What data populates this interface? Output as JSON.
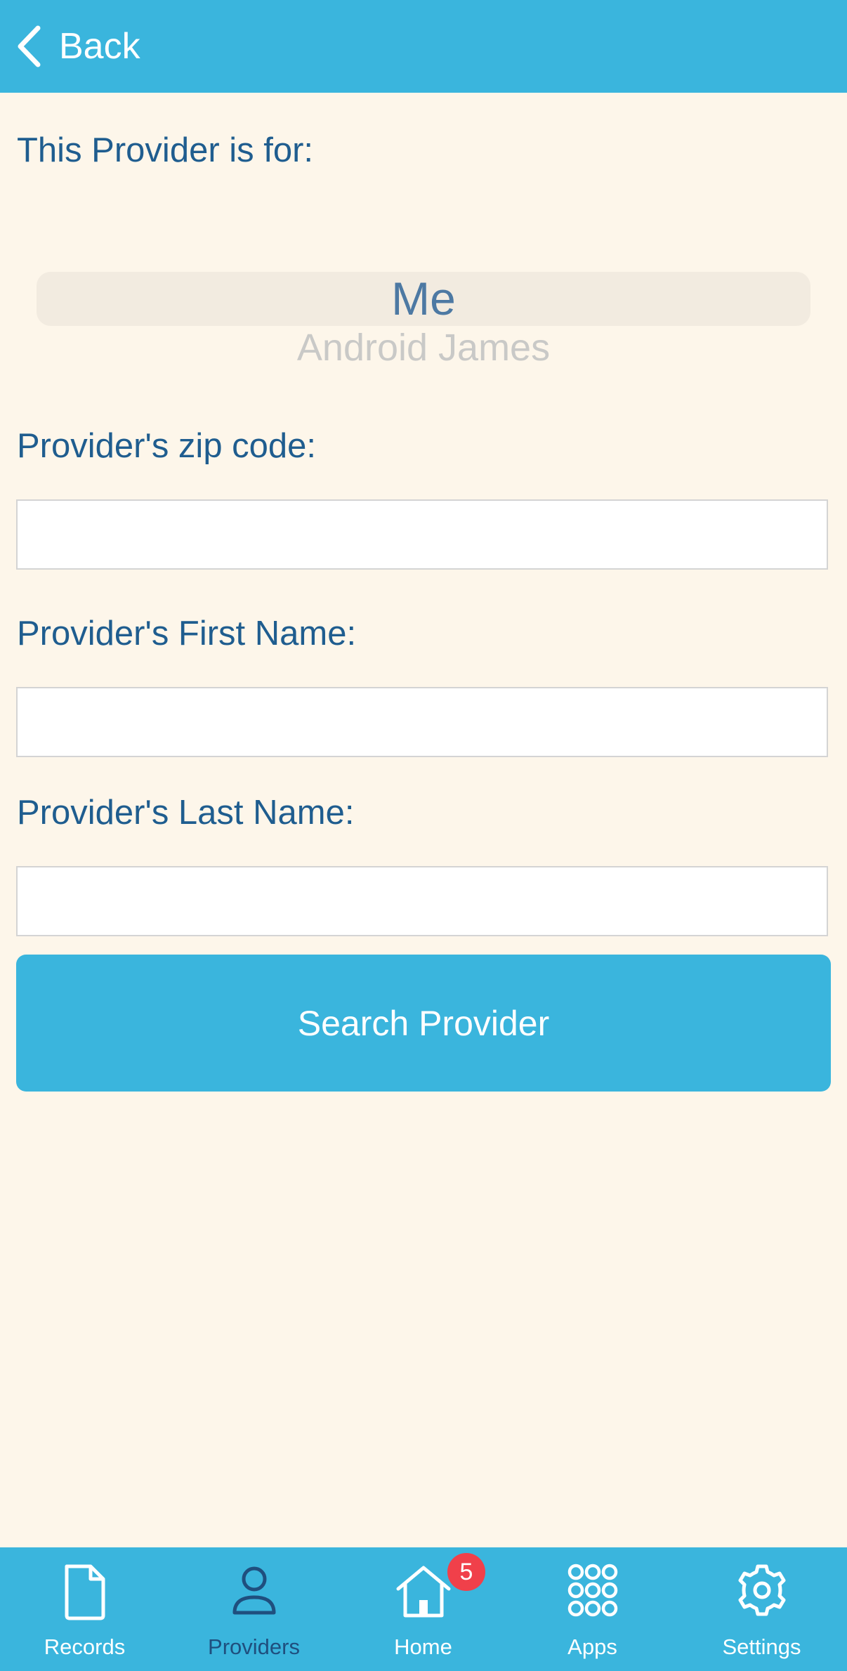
{
  "header": {
    "back_label": "Back"
  },
  "form": {
    "for_label": "This Provider is for:",
    "picker": {
      "selected": "Me",
      "next": "Android James"
    },
    "zip_label": "Provider's zip code:",
    "zip_value": "",
    "first_name_label": "Provider's First Name:",
    "first_name_value": "",
    "last_name_label": "Provider's Last Name:",
    "last_name_value": "",
    "search_label": "Search Provider"
  },
  "tabbar": {
    "tabs": [
      {
        "label": "Records",
        "icon": "document-icon",
        "active": false
      },
      {
        "label": "Providers",
        "icon": "person-icon",
        "active": true
      },
      {
        "label": "Home",
        "icon": "home-icon",
        "active": false,
        "badge": "5"
      },
      {
        "label": "Apps",
        "icon": "grid-icon",
        "active": false
      },
      {
        "label": "Settings",
        "icon": "gear-icon",
        "active": false
      }
    ]
  },
  "colors": {
    "accent": "#3ab5dd",
    "background": "#fdf6ea",
    "text": "#1f5d8f",
    "active_tab": "#1f4f7e",
    "badge": "#f0404a"
  }
}
